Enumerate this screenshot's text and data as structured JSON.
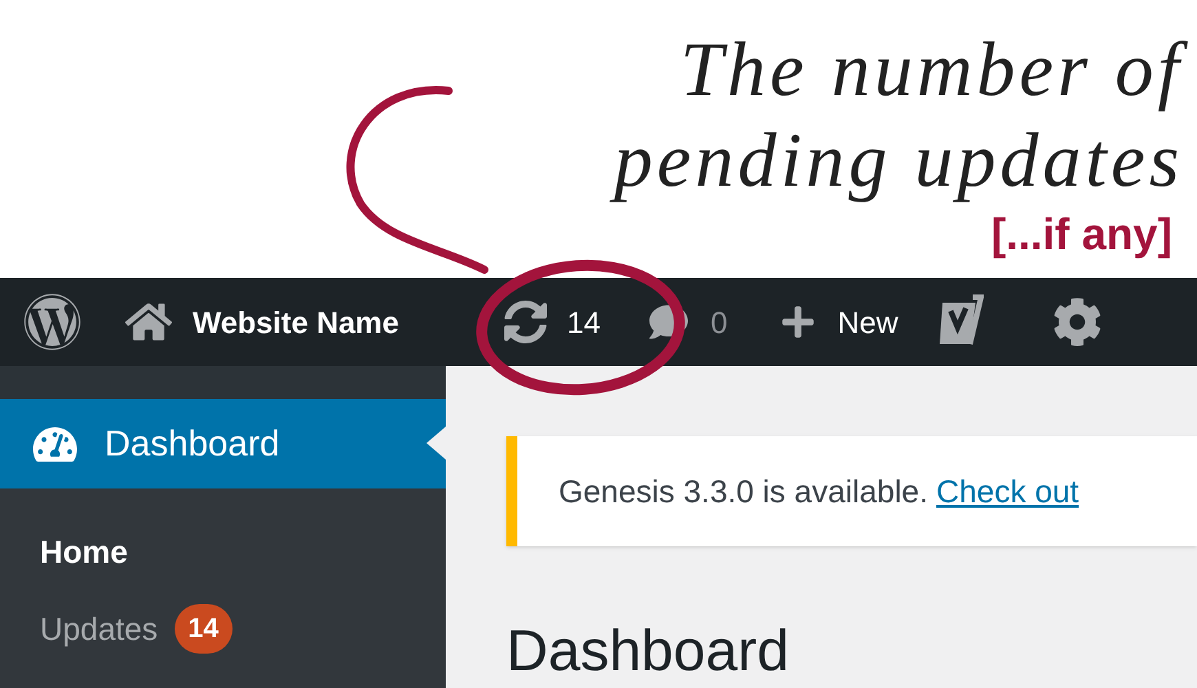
{
  "annotation": {
    "lines": [
      "The number of",
      "pending updates"
    ],
    "note": "[...if any]"
  },
  "admin_bar": {
    "site_name": "Website Name",
    "updates_count": "14",
    "comments_count": "0",
    "new_label": "New"
  },
  "sidebar": {
    "items": [
      {
        "label": "Dashboard",
        "selected": true,
        "children": [
          {
            "label": "Home",
            "selected": true
          },
          {
            "label": "Updates",
            "selected": false,
            "badge": "14"
          }
        ]
      }
    ]
  },
  "notice": {
    "text": "Genesis 3.3.0 is available.",
    "link": "Check out"
  },
  "page_title": "Dashboard"
}
